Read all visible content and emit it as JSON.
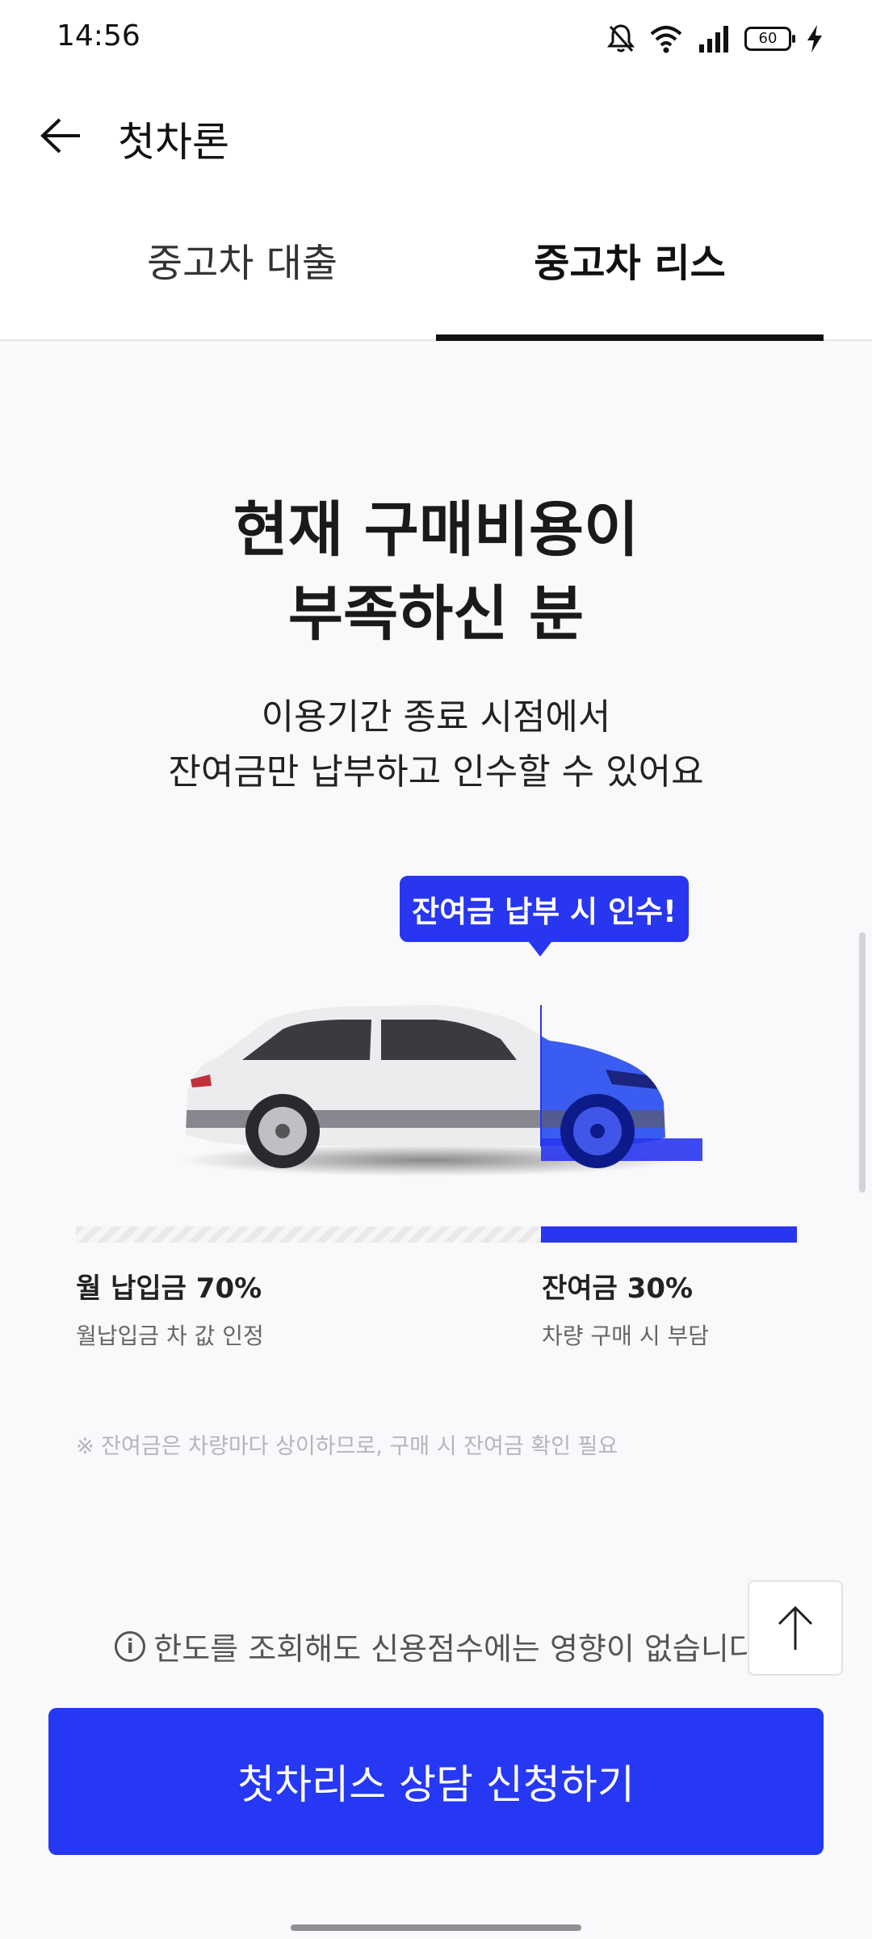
{
  "status_bar": {
    "time": "14:56",
    "battery": "60",
    "icons": [
      "mute-icon",
      "wifi-icon",
      "signal-icon",
      "battery-icon",
      "charging-icon"
    ]
  },
  "app_bar": {
    "title": "첫차론",
    "back_icon": "back-arrow-icon"
  },
  "tabs": [
    {
      "label": "중고차 대출",
      "active": false
    },
    {
      "label": "중고차 리스",
      "active": true
    }
  ],
  "hero": {
    "headline_line1": "현재 구매비용이",
    "headline_line2": "부족하신 분",
    "sub_line1": "이용기간 종료 시점에서",
    "sub_line2": "잔여금만 납부하고 인수할 수 있어요",
    "bubble": "잔여금 납부 시 인수!"
  },
  "split": {
    "monthly_percent": 70,
    "residual_percent": 30,
    "monthly_title": "월 납입금 70%",
    "monthly_desc": "월납입금 차 값 인정",
    "residual_title": "잔여금 30%",
    "residual_desc": "차량 구매 시 부담"
  },
  "note": "※  잔여금은 차량마다 상이하므로, 구매 시 잔여금 확인 필요",
  "info": {
    "icon": "info-icon",
    "text": "한도를 조회해도 신용점수에는 영향이 없습니다"
  },
  "cta": {
    "label": "첫차리스 상담 신청하기"
  },
  "colors": {
    "accent": "#2638F4",
    "text": "#1A1A1A",
    "background": "#F9F9FB"
  }
}
